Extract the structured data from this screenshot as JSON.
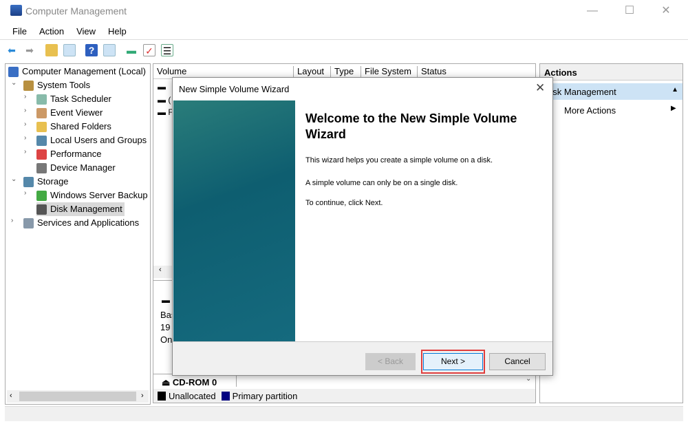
{
  "window": {
    "title": "Computer Management",
    "minimize": "—",
    "maximize": "☐",
    "close": "✕"
  },
  "menu": [
    "File",
    "Action",
    "View",
    "Help"
  ],
  "toolbar": [
    "back-arrow-icon",
    "forward-arrow-icon",
    "up-folder-icon",
    "show-hide-tree-icon",
    "help-icon",
    "action-pane-icon",
    "connect-icon",
    "properties-icon",
    "list-icon"
  ],
  "tree": {
    "root": "Computer Management (Local)",
    "items": [
      {
        "label": "System Tools",
        "level": 1,
        "expanded": true
      },
      {
        "label": "Task Scheduler",
        "level": 2
      },
      {
        "label": "Event Viewer",
        "level": 2
      },
      {
        "label": "Shared Folders",
        "level": 2
      },
      {
        "label": "Local Users and Groups",
        "level": 2
      },
      {
        "label": "Performance",
        "level": 2
      },
      {
        "label": "Device Manager",
        "level": 2
      },
      {
        "label": "Storage",
        "level": 1,
        "expanded": true
      },
      {
        "label": "Windows Server Backup",
        "level": 2
      },
      {
        "label": "Disk Management",
        "level": 2,
        "selected": true
      },
      {
        "label": "Services and Applications",
        "level": 1
      }
    ]
  },
  "center": {
    "columns": [
      "Volume",
      "Layout",
      "Type",
      "File System",
      "Status"
    ],
    "rows_partial": [
      "",
      "(",
      "F"
    ],
    "disk_partial": [
      "Bas",
      "19",
      "On"
    ],
    "cdrom": "CD-ROM 0",
    "legend": [
      {
        "label": "Unallocated",
        "color": "#000000"
      },
      {
        "label": "Primary partition",
        "color": "#000080"
      }
    ]
  },
  "actions": {
    "header": "Actions",
    "section": "Disk Management",
    "more": "More Actions"
  },
  "dialog": {
    "title": "New Simple Volume Wizard",
    "heading": "Welcome to the New Simple Volume Wizard",
    "p1": "This wizard helps you create a simple volume on a disk.",
    "p2": "A simple volume can only be on a single disk.",
    "p3": "To continue, click Next.",
    "back": "< Back",
    "next": "Next >",
    "cancel": "Cancel",
    "highlight_color": "#e03c3c"
  }
}
